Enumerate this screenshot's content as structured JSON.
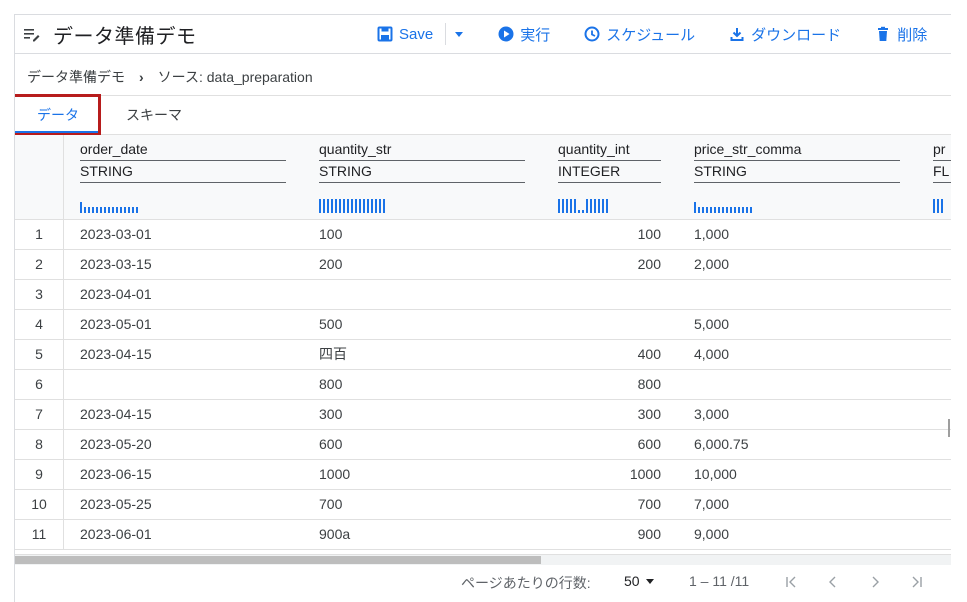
{
  "toolbar": {
    "title": "データ準備デモ",
    "save": "Save",
    "run": "実行",
    "schedule": "スケジュール",
    "download": "ダウンロード",
    "delete": "削除"
  },
  "breadcrumb": {
    "root": "データ準備デモ",
    "source": "ソース: data_preparation"
  },
  "tabs": [
    "データ",
    "スキーマ"
  ],
  "columns": [
    {
      "name": "order_date",
      "type": "STRING"
    },
    {
      "name": "quantity_str",
      "type": "STRING"
    },
    {
      "name": "quantity_int",
      "type": "INTEGER"
    },
    {
      "name": "price_str_comma",
      "type": "STRING"
    },
    {
      "name": "pr",
      "type": "FL"
    }
  ],
  "rows": [
    [
      "1",
      "2023-03-01",
      "100",
      "100",
      "1,000"
    ],
    [
      "2",
      "2023-03-15",
      "200",
      "200",
      "2,000"
    ],
    [
      "3",
      "2023-04-01",
      "",
      "",
      ""
    ],
    [
      "4",
      "2023-05-01",
      "500",
      "",
      "5,000"
    ],
    [
      "5",
      "2023-04-15",
      "四百",
      "400",
      "4,000"
    ],
    [
      "6",
      "",
      "800",
      "800",
      ""
    ],
    [
      "7",
      "2023-04-15",
      "300",
      "300",
      "3,000"
    ],
    [
      "8",
      "2023-05-20",
      "600",
      "600",
      "6,000.75"
    ],
    [
      "9",
      "2023-06-15",
      "1000",
      "1000",
      "10,000"
    ],
    [
      "10",
      "2023-05-25",
      "700",
      "700",
      "7,000"
    ],
    [
      "11",
      "2023-06-01",
      "900a",
      "900",
      "9,000"
    ]
  ],
  "pager": {
    "rows_per_page_label": "ページあたりの行数:",
    "rows_per_page": "50",
    "range": "1 – 11 /11"
  },
  "colors": {
    "accent": "#1a73e8",
    "highlight_border": "#b71c1c"
  }
}
